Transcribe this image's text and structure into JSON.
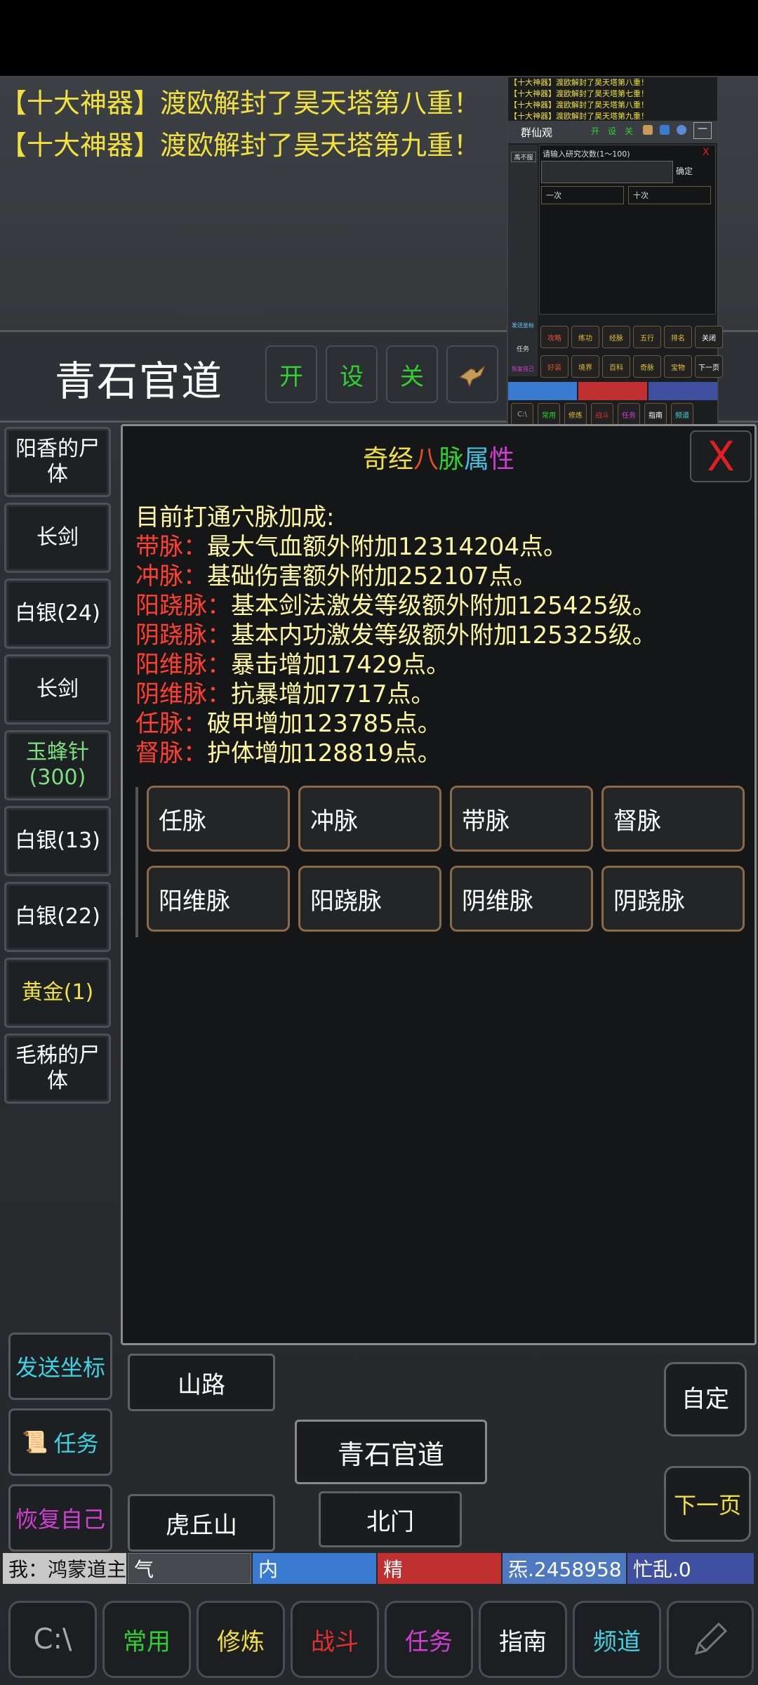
{
  "announcements": [
    "【十大神器】渡欧解封了昊天塔第八重！",
    "【十大神器】渡欧解封了昊天塔第九重！"
  ],
  "location": {
    "title": "青石官道",
    "quick": [
      "开",
      "设",
      "关"
    ]
  },
  "overlay": {
    "logs": [
      "【十大神器】渡欧解封了昊天塔第八重！",
      "【十大神器】渡欧解封了昊天塔第七重！",
      "【十大神器】渡欧解封了昊天塔第八重！",
      "【十大神器】渡欧解封了昊天塔第九重！"
    ],
    "title": "群仙观",
    "icons": [
      "开",
      "设",
      "关"
    ],
    "side_label": "禹不服",
    "prompt": "请输入研究次数(1～100)",
    "confirm": "确定",
    "once": "一次",
    "ten": "十次",
    "send": "发送坐标",
    "task": "任务",
    "recover": "恢复自己",
    "grid1": [
      "攻略",
      "练功",
      "经脉",
      "五行",
      "排名",
      "关闭"
    ],
    "grid2": [
      "好装",
      "境界",
      "百科",
      "奇脉",
      "宝物",
      "下一页"
    ],
    "bottom": [
      "常用",
      "修炼",
      "战斗",
      "任务",
      "指南",
      "频道"
    ]
  },
  "items": [
    "阳香的尸体",
    "长剑",
    "白银(24)",
    "长剑",
    "玉蜂针(300)",
    "白银(13)",
    "白银(22)",
    "黄金(1)",
    "毛秭的尸体"
  ],
  "panel": {
    "title_parts": [
      "奇经",
      "八",
      "脉",
      "属",
      "性"
    ],
    "close": "X",
    "heading": "目前打通穴脉加成:",
    "attrs": [
      {
        "k": "带脉：",
        "v": "最大气血额外附加12314204点。"
      },
      {
        "k": "冲脉：",
        "v": "基础伤害额外附加252107点。"
      },
      {
        "k": "阳跷脉：",
        "v": "基本剑法激发等级额外附加125425级。"
      },
      {
        "k": "阴跷脉：",
        "v": "基本内功激发等级额外附加125325级。"
      },
      {
        "k": "阳维脉：",
        "v": "暴击增加17429点。"
      },
      {
        "k": "阴维脉：",
        "v": "抗暴增加7717点。"
      },
      {
        "k": "任脉：",
        "v": "破甲增加123785点。"
      },
      {
        "k": "督脉：",
        "v": "护体增加128819点。"
      }
    ],
    "meridians": [
      "任脉",
      "冲脉",
      "带脉",
      "督脉",
      "阳维脉",
      "阳跷脉",
      "阴维脉",
      "阴跷脉"
    ]
  },
  "side_buttons": [
    "发送坐标",
    "任务",
    "恢复自己"
  ],
  "nav": {
    "up": "山路",
    "center": "青石官道",
    "down_left": "虎丘山",
    "down": "北门",
    "auto": "自定",
    "next": "下一页"
  },
  "status": {
    "player": "我：鸿蒙道主",
    "qi": "气",
    "nei": "内",
    "jing": "精",
    "money": "炁.2458958",
    "busy": "忙乱.0"
  },
  "tabs": [
    "C:\\",
    "常用",
    "修炼",
    "战斗",
    "任务",
    "指南",
    "频道"
  ],
  "colors": {
    "announce": "#f0e040",
    "green": "#2fd02f",
    "red": "#e02020",
    "attr_key": "#ff4030",
    "attr_val": "#fff8a0"
  }
}
